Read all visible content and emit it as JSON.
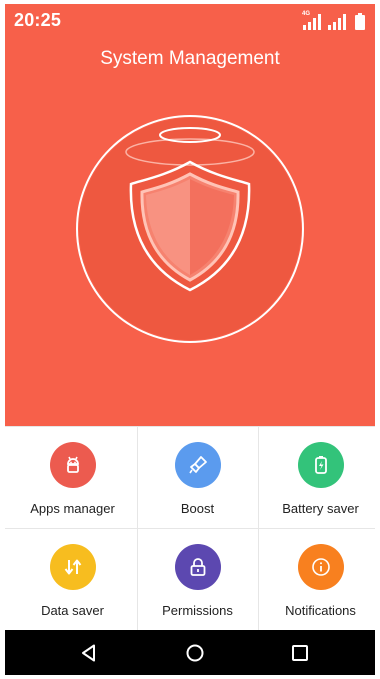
{
  "status_bar": {
    "time": "20:25",
    "network_label": "4G",
    "icons": [
      "signal-icon",
      "signal-icon",
      "battery-icon"
    ]
  },
  "hero": {
    "title": "System Management",
    "background_color": "#f7604a",
    "icon": "shield-icon"
  },
  "tiles": [
    {
      "label": "Apps manager",
      "icon": "android-icon",
      "color": "#ec5b4f"
    },
    {
      "label": "Boost",
      "icon": "broom-icon",
      "color": "#5b9bee"
    },
    {
      "label": "Battery saver",
      "icon": "battery-bolt-icon",
      "color": "#33c37a"
    },
    {
      "label": "Data saver",
      "icon": "data-arrows-icon",
      "color": "#f7bd1f"
    },
    {
      "label": "Permissions",
      "icon": "lock-icon",
      "color": "#5c48b0"
    },
    {
      "label": "Notifications",
      "icon": "info-icon",
      "color": "#f8801f"
    }
  ],
  "nav_bar": {
    "icons": [
      "back-icon",
      "home-icon",
      "recents-icon"
    ]
  }
}
